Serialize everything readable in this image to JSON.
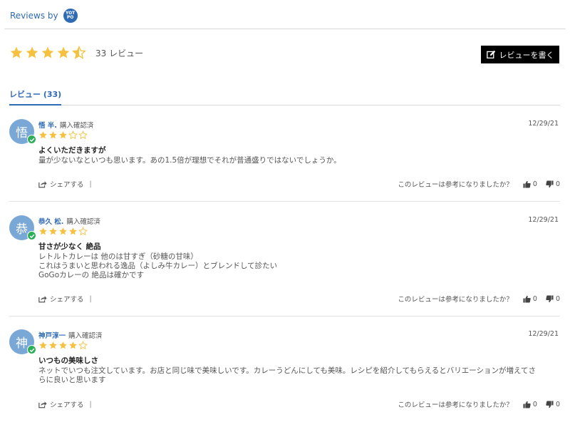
{
  "header": {
    "reviews_by": "Reviews by",
    "logo_text": "YOT PO"
  },
  "summary": {
    "rating": 4.5,
    "count_label": "33 レビュー",
    "star_color": "#f5c13e"
  },
  "write_review": {
    "label": "レビューを書く"
  },
  "tabs": [
    {
      "label": "レビュー (33)",
      "active": true
    }
  ],
  "reviews": [
    {
      "avatar": "悟",
      "name": "悟 半.",
      "buyer_label": "購入確認済",
      "date": "12/29/21",
      "rating": 3,
      "title": "よくいただきますが",
      "body": [
        "量が少ないなといつも思います。あの1.5倍が理想でそれが普通盛りではないでしょうか。"
      ]
    },
    {
      "avatar": "恭",
      "name": "恭久 松.",
      "buyer_label": "購入確認済",
      "date": "12/29/21",
      "rating": 4,
      "title": "甘さが少なく 絶品",
      "body": [
        "レトルトカレーは 他のは甘すぎ（砂糖の甘味）",
        "これはうまいと思われる逸品（よしみ牛カレー）とブレンドして診たい",
        "GoGoカレーの 絶品は確かです"
      ]
    },
    {
      "avatar": "神",
      "name": "神戸淳一",
      "buyer_label": "購入確認済",
      "date": "12/29/21",
      "rating": 4,
      "title": "いつもの美味しさ",
      "body": [
        "ネットでいつも注文しています。お店と同じ味で美味しいです。カレーうどんにしても美味。レシピを紹介してもらえるとバリエーションが増えてさ",
        "らに良いと思います"
      ]
    }
  ],
  "footer": {
    "share_label": "シェアする",
    "separator": "|",
    "helpful_question": "このレビューは参考になりましたか？",
    "up_count": "0",
    "down_count": "0"
  },
  "colors": {
    "accent": "#2f6ab5",
    "verified": "#2fae5a",
    "avatar_bg": "#7aa8d6"
  }
}
